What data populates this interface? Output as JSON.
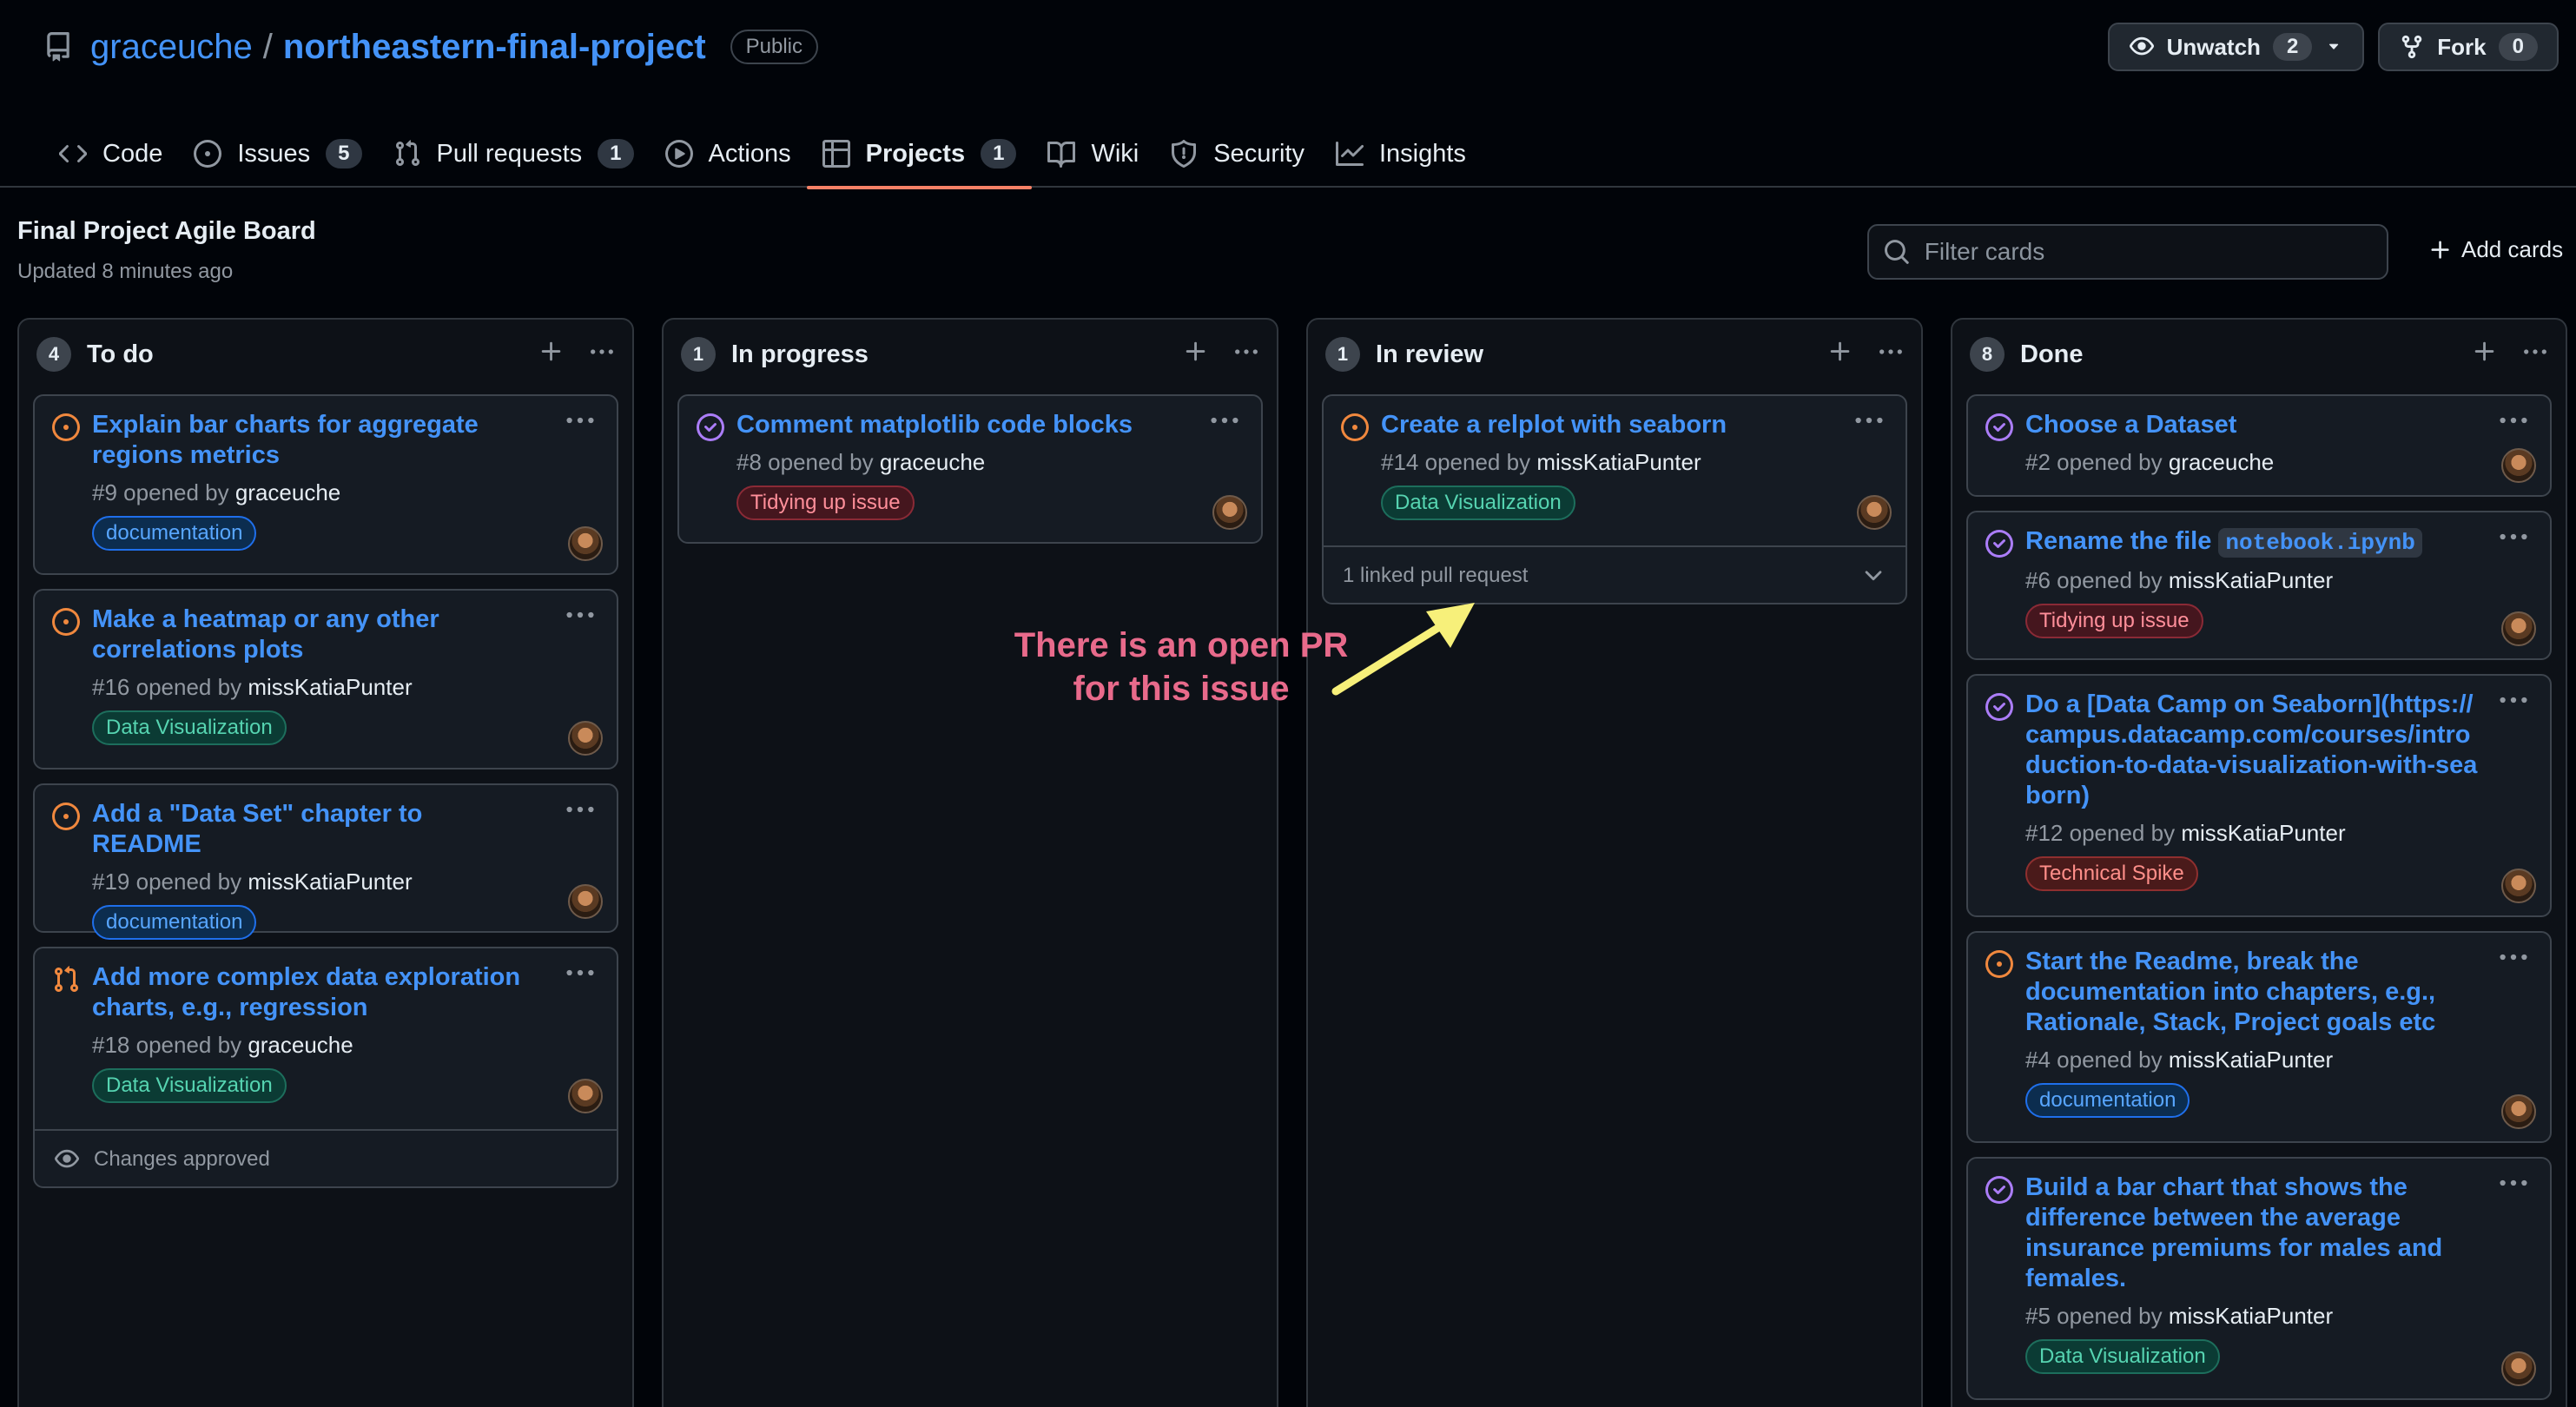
{
  "repo": {
    "owner": "graceuche",
    "separator": "/",
    "name": "northeastern-final-project",
    "visibility": "Public"
  },
  "actions": {
    "watch": {
      "label": "Unwatch",
      "count": "2"
    },
    "fork": {
      "label": "Fork",
      "count": "0"
    }
  },
  "tabs": [
    {
      "label": "Code"
    },
    {
      "label": "Issues",
      "count": "5"
    },
    {
      "label": "Pull requests",
      "count": "1"
    },
    {
      "label": "Actions"
    },
    {
      "label": "Projects",
      "count": "1"
    },
    {
      "label": "Wiki"
    },
    {
      "label": "Security"
    },
    {
      "label": "Insights"
    }
  ],
  "board": {
    "title": "Final Project Agile Board",
    "updated": "Updated 8 minutes ago"
  },
  "filter": {
    "placeholder": "Filter cards"
  },
  "add_cards": "Add cards",
  "columns": [
    {
      "count": "4",
      "name": "To do",
      "cards": [
        {
          "title": "Explain bar charts for aggregate regions metrics",
          "number": "#9",
          "opened_by": "opened by",
          "author": "graceuche",
          "label": "documentation"
        },
        {
          "title": "Make a heatmap or any other correlations plots",
          "number": "#16",
          "opened_by": "opened by",
          "author": "missKatiaPunter",
          "label": "Data Visualization"
        },
        {
          "title": "Add a \"Data Set\" chapter to README",
          "number": "#19",
          "opened_by": "opened by",
          "author": "missKatiaPunter",
          "label": "documentation"
        },
        {
          "title": "Add more complex data exploration charts, e.g., regression",
          "number": "#18",
          "opened_by": "opened by",
          "author": "graceuche",
          "label": "Data Visualization",
          "footer": "Changes approved"
        }
      ]
    },
    {
      "count": "1",
      "name": "In progress",
      "cards": [
        {
          "title": "Comment matplotlib code blocks",
          "number": "#8",
          "opened_by": "opened by",
          "author": "graceuche",
          "label": "Tidying up issue"
        }
      ]
    },
    {
      "count": "1",
      "name": "In review",
      "cards": [
        {
          "title": "Create a relplot with seaborn",
          "number": "#14",
          "opened_by": "opened by",
          "author": "missKatiaPunter",
          "label": "Data Visualization",
          "footer": "1 linked pull request"
        }
      ]
    },
    {
      "count": "8",
      "name": "Done",
      "cards": [
        {
          "title": "Choose a Dataset",
          "number": "#2",
          "opened_by": "opened by",
          "author": "graceuche"
        },
        {
          "title_prefix": "Rename the file",
          "title_code": "notebook.ipynb",
          "number": "#6",
          "opened_by": "opened by",
          "author": "missKatiaPunter",
          "label": "Tidying up issue"
        },
        {
          "title": "Do a [Data Camp on Seaborn](https://campus.datacamp.com/courses/introduction-to-data-visualization-with-seaborn)",
          "number": "#12",
          "opened_by": "opened by",
          "author": "missKatiaPunter",
          "label": "Technical Spike"
        },
        {
          "title": "Start the Readme, break the documentation into chapters, e.g., Rationale, Stack, Project goals etc",
          "number": "#4",
          "opened_by": "opened by",
          "author": "missKatiaPunter",
          "label": "documentation"
        },
        {
          "title": "Build a bar chart that shows the difference between the average insurance premiums for males and females.",
          "number": "#5",
          "opened_by": "opened by",
          "author": "missKatiaPunter",
          "label": "Data Visualization"
        }
      ]
    }
  ],
  "annotation": {
    "line1": "There is an open PR",
    "line2": "for this issue"
  },
  "colors": {
    "background": "#010409",
    "link": "#4493f8",
    "tab_underline": "#f78166",
    "open_issue": "#f0883e",
    "closed_issue": "#ab7df8",
    "annotation": "#e86a8b",
    "arrow": "#f7f07a"
  }
}
